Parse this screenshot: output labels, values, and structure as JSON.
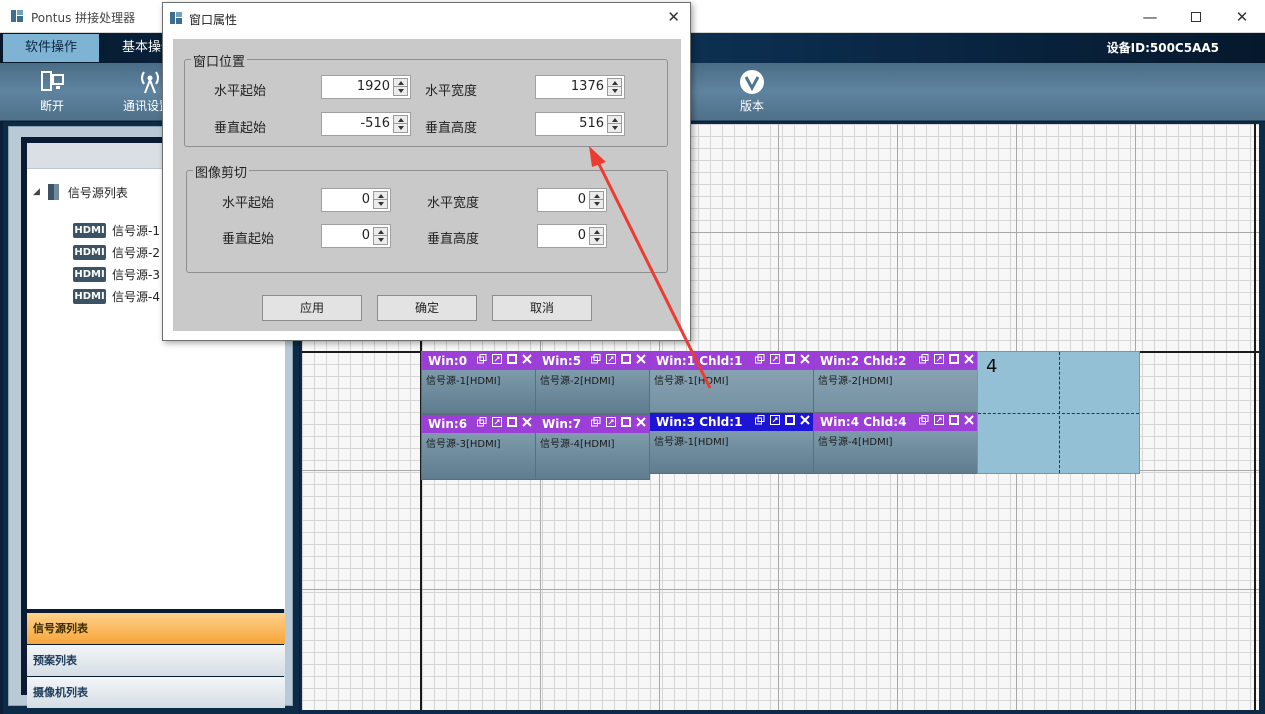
{
  "app": {
    "title": "Pontus 拼接处理器",
    "device_id": "设备ID:500C5AA5"
  },
  "menu": {
    "tabs": [
      {
        "label": "软件操作"
      },
      {
        "label": "基本操作"
      }
    ]
  },
  "toolbar": {
    "disconnect": "断开",
    "comm": "通讯设置",
    "version": "版本"
  },
  "tree": {
    "root": "信号源列表",
    "items": [
      {
        "badge": "HDMI",
        "label": "信号源-1"
      },
      {
        "badge": "HDMI",
        "label": "信号源-2"
      },
      {
        "badge": "HDMI",
        "label": "信号源-3"
      },
      {
        "badge": "HDMI",
        "label": "信号源-4"
      }
    ]
  },
  "bottom_tabs": [
    {
      "label": "信号源列表"
    },
    {
      "label": "预案列表"
    },
    {
      "label": "摄像机列表"
    }
  ],
  "windows": [
    {
      "title": "Win:0",
      "source": "信号源-1[HDMI]"
    },
    {
      "title": "Win:5",
      "source": "信号源-2[HDMI]"
    },
    {
      "title": "Win:1 Chld:1",
      "source": "信号源-1[HDMI]"
    },
    {
      "title": "Win:2 Chld:2",
      "source": "信号源-2[HDMI]"
    },
    {
      "title": "Win:6",
      "source": "信号源-3[HDMI]"
    },
    {
      "title": "Win:7",
      "source": "信号源-4[HDMI]"
    },
    {
      "title": "Win:3 Chld:1",
      "source": "信号源-1[HDMI]"
    },
    {
      "title": "Win:4 Chld:4",
      "source": "信号源-4[HDMI]"
    }
  ],
  "empty_window_label": "4",
  "dialog": {
    "title": "窗口属性",
    "position_group": "窗口位置",
    "crop_group": "图像剪切",
    "h_start": "水平起始",
    "h_width": "水平宽度",
    "v_start": "垂直起始",
    "v_height": "垂直高度",
    "position_values": {
      "h_start": "1920",
      "h_width": "1376",
      "v_start": "-516",
      "v_height": "516"
    },
    "crop_values": {
      "h_start": "0",
      "h_width": "0",
      "v_start": "0",
      "v_height": "0"
    },
    "apply": "应用",
    "ok": "确定",
    "cancel": "取消"
  },
  "colors": {
    "win_bar": "#9b3fd6",
    "win_bar_active": "#1c15d6",
    "annotation_arrow": "#ee3b32"
  }
}
